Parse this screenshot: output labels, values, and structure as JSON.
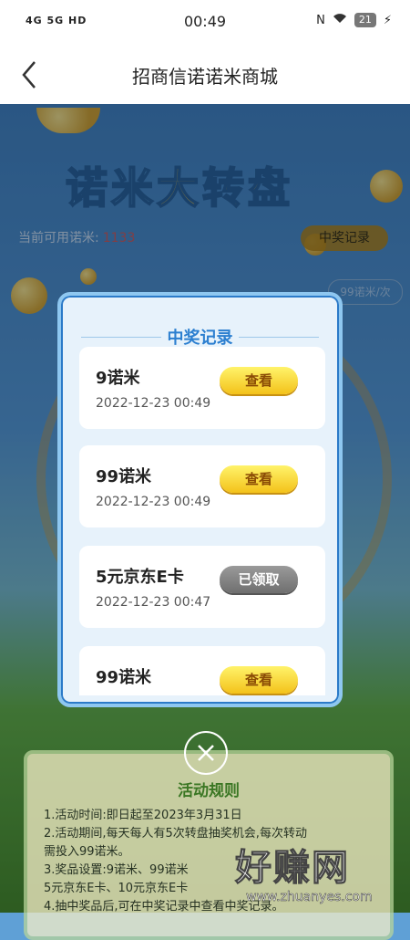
{
  "status_bar": {
    "signal_text": "4G  5G  HD",
    "time": "00:49",
    "battery": "21"
  },
  "nav": {
    "title": "招商信诺诺米商城"
  },
  "background": {
    "game_title_part1": "诺米",
    "game_title_part2": "大转盘",
    "available_label": "当前可用诺米:",
    "available_value": "1133",
    "records_button": "中奖记录",
    "cost_label": "99诺米/次"
  },
  "modal": {
    "title": "中奖记录",
    "records": [
      {
        "name": "9诺米",
        "date": "2022-12-23 00:49",
        "action": "查看",
        "status": "view"
      },
      {
        "name": "99诺米",
        "date": "2022-12-23 00:49",
        "action": "查看",
        "status": "view"
      },
      {
        "name": "5元京东E卡",
        "date": "2022-12-23 00:47",
        "action": "已领取",
        "status": "done"
      },
      {
        "name": "99诺米",
        "date": "",
        "action": "查看",
        "status": "view"
      }
    ]
  },
  "rules": {
    "title": "活动规则",
    "lines": [
      "1.活动时间:即日起至2023年3月31日",
      "2.活动期间,每天每人有5次转盘抽奖机会,每次转动",
      "需投入99诺米。",
      "3.奖品设置:9诺米、99诺米",
      "5元京东E卡、10元京东E卡",
      "4.抽中奖品后,可在中奖记录中查看中奖记录。"
    ]
  },
  "watermark": {
    "text": "好赚网",
    "url": "www.zhuanyes.com"
  },
  "colors": {
    "modal_title": "#2c7fd0",
    "view_button": "#f3c21a",
    "done_button": "#6f6f6f"
  }
}
